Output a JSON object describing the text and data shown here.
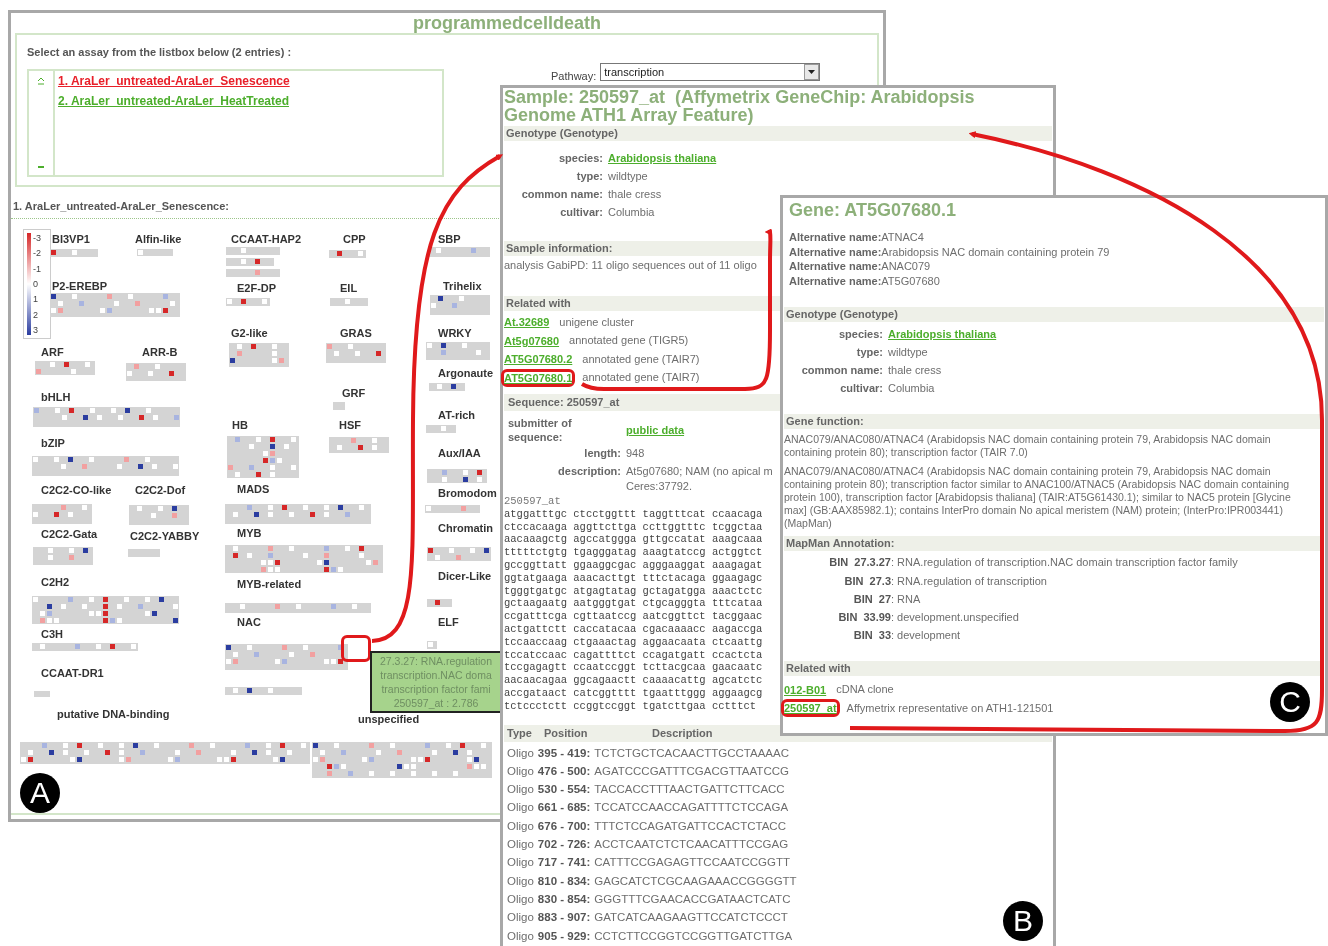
{
  "panel_a": {
    "title": "programmedcelldeath",
    "prompt": "Select an assay from the listbox below (2 entries) :",
    "assays": [
      {
        "label": "1. AraLer_untreated-AraLer_Senescence",
        "selected": true
      },
      {
        "label": "2. AraLer_untreated-AraLer_HeatTreated",
        "selected": false
      }
    ],
    "pathway": {
      "label": "Pathway:",
      "value": "transcription"
    },
    "assay_heading": "1. AraLer_untreated-AraLer_Senescence:",
    "legend": [
      "-3",
      "-2",
      "-1",
      "0",
      "1",
      "2",
      "3"
    ],
    "groups": [
      {
        "label": "BI3VP1"
      },
      {
        "label": "Alfin-like"
      },
      {
        "label": "CCAAT-HAP2"
      },
      {
        "label": "CPP"
      },
      {
        "label": "SBP"
      },
      {
        "label": "P2-EREBP"
      },
      {
        "label": "E2F-DP"
      },
      {
        "label": "EIL"
      },
      {
        "label": "Trihelix"
      },
      {
        "label": "G2-like"
      },
      {
        "label": "GRAS"
      },
      {
        "label": "WRKY"
      },
      {
        "label": "ARF"
      },
      {
        "label": "ARR-B"
      },
      {
        "label": "Argonaute"
      },
      {
        "label": "bHLH"
      },
      {
        "label": "GRF"
      },
      {
        "label": "AT-rich"
      },
      {
        "label": "HB"
      },
      {
        "label": "HSF"
      },
      {
        "label": "bZIP"
      },
      {
        "label": "Aux/IAA"
      },
      {
        "label": "C2C2-CO-like"
      },
      {
        "label": "C2C2-Dof"
      },
      {
        "label": "MADS"
      },
      {
        "label": "Bromodom"
      },
      {
        "label": "C2C2-Gata"
      },
      {
        "label": "C2C2-YABBY"
      },
      {
        "label": "MYB"
      },
      {
        "label": "Chromatin"
      },
      {
        "label": "C2H2"
      },
      {
        "label": "MYB-related"
      },
      {
        "label": "Dicer-Like"
      },
      {
        "label": "C3H"
      },
      {
        "label": "NAC"
      },
      {
        "label": "ELF"
      },
      {
        "label": "CCAAT-DR1"
      },
      {
        "label": "putative DNA-binding"
      },
      {
        "label": "unspecified"
      }
    ],
    "tooltip": {
      "lines": [
        "27.3.27: RNA.regulation",
        "transcription.NAC doma",
        "transcription factor fami",
        "250597_at : 2.786"
      ]
    },
    "badge": "A"
  },
  "panel_b": {
    "title": "Sample: 250597_at  (Affymetrix GeneChip: Arabidopsis Genome ATH1 Array Feature)",
    "genotype_header": "Genotype (Genotype)",
    "genotype": [
      {
        "key": "species:",
        "value": "Arabidopsis thaliana",
        "kind": "link"
      },
      {
        "key": "type:",
        "value": "wildtype",
        "kind": "text"
      },
      {
        "key": "common name:",
        "value": "thale cress",
        "kind": "text"
      },
      {
        "key": "cultivar:",
        "value": "Columbia",
        "kind": "text"
      }
    ],
    "sample_info_header": "Sample information:",
    "sample_info": "analysis GabiPD: 11 oligo sequences out of 11 oligo",
    "related_header": "Related with",
    "related": [
      {
        "id": "At.32689",
        "desc": "unigene cluster",
        "highlighted": false
      },
      {
        "id": "At5g07680",
        "desc": "annotated gene (TIGR5)",
        "highlighted": false
      },
      {
        "id": "AT5G07680.2",
        "desc": "annotated gene (TAIR7)",
        "highlighted": false
      },
      {
        "id": "AT5G07680.1",
        "desc": "annotated gene (TAIR7)",
        "highlighted": true
      }
    ],
    "sequence_header": "Sequence: 250597_at",
    "submitter_key": "submitter of sequence:",
    "submitter": "public data",
    "length_key": "length:",
    "length": "948",
    "description_key": "description:",
    "description": [
      "At5g07680; NAM (no apical m",
      "Ceres:37792."
    ],
    "sequence_name": "250597_at",
    "sequence_lines": [
      "atggatttgc ctcctggttt taggtttcat ccaacaga",
      "ctccacaaga aggttcttga ccttggtttc tcggctaa",
      "aacaaagctg agccatggga gttgccatat aaagcaaa",
      "tttttctgtg tgagggatag aaagtatccg actggtct",
      "gccggttatt ggaaggcgac agggaaggat aaagagat",
      "ggtatgaaga aaacacttgt tttctacaga ggaagagc",
      "tgggtgatgc atgagtatag gctagatgga aaactctc",
      "gctaagaatg aatgggtgat ctgcagggta tttcataa",
      "ccgatttcga cgttaatccg aatcggttct tacggaac",
      "actgattctt caccatacaa cgacaaaacc aagaccga",
      "tccaaccaag ctgaaactag aggaacaata ctcaattg",
      "tccatccaac cagattttct ccagatgatt ccactcta",
      "tccgagagtt ccaatccggt tcttacgcaa gaacaatc",
      "aacaacagaa ggcagaactt caaaacattg agcatctc",
      "accgataact catcggtttt tgaatttggg aggaagcg",
      "tctccctctt ccggtccggt tgatcttgaa cctttct"
    ],
    "oligo_columns": [
      "Type",
      "Position",
      "Description"
    ],
    "oligos": [
      {
        "type": "Oligo",
        "position": "395 - 419:",
        "sequence": "TCTCTGCTCACAACTTGCCTAAAAC"
      },
      {
        "type": "Oligo",
        "position": "476 - 500:",
        "sequence": "AGATCCCGATTTCGACGTTAATCCG"
      },
      {
        "type": "Oligo",
        "position": "530 - 554:",
        "sequence": "TACCACCTTTAACTGATTCTTCACC"
      },
      {
        "type": "Oligo",
        "position": "661 - 685:",
        "sequence": "TCCATCCAACCAGATTTTCTCCAGA"
      },
      {
        "type": "Oligo",
        "position": "676 - 700:",
        "sequence": "TTTCTCCAGATGATTCCACTCTACC"
      },
      {
        "type": "Oligo",
        "position": "702 - 726:",
        "sequence": "ACCTCAATCTCTCAACATTTCCGAG"
      },
      {
        "type": "Oligo",
        "position": "717 - 741:",
        "sequence": "CATTTCCGAGAGTTCCAATCCGGTT"
      },
      {
        "type": "Oligo",
        "position": "810 - 834:",
        "sequence": "GAGCATCTCGCAAGAAACCGGGGTT"
      },
      {
        "type": "Oligo",
        "position": "830 - 854:",
        "sequence": "GGGTTTCGAACACCGATAACTCATC"
      },
      {
        "type": "Oligo",
        "position": "883 - 907:",
        "sequence": "GATCATCAAGAAGTTCCATCTCCCT"
      },
      {
        "type": "Oligo",
        "position": "905 - 929:",
        "sequence": "CCTCTTCCGGTCCGGTTGATCTTGA"
      }
    ],
    "badge": "B"
  },
  "panel_c": {
    "title": "Gene: AT5G07680.1",
    "alt_names": [
      {
        "key": "Alternative name:",
        "value": "ATNAC4"
      },
      {
        "key": "Alternative name:",
        "value": "Arabidopsis NAC domain containing protein 79"
      },
      {
        "key": "Alternative name:",
        "value": "ANAC079"
      },
      {
        "key": "Alternative name:",
        "value": "AT5G07680"
      }
    ],
    "genotype_header": "Genotype (Genotype)",
    "genotype": [
      {
        "key": "species:",
        "value": "Arabidopsis thaliana",
        "kind": "link"
      },
      {
        "key": "type:",
        "value": "wildtype",
        "kind": "text"
      },
      {
        "key": "common name:",
        "value": "thale cress",
        "kind": "text"
      },
      {
        "key": "cultivar:",
        "value": "Columbia",
        "kind": "text"
      }
    ],
    "function_header": "Gene function:",
    "functions": [
      "ANAC079/ANAC080/ATNAC4 (Arabidopsis NAC domain containing protein 79, Arabidopsis NAC domain containing protein 80); transcription factor (TAIR 7.0)",
      "ANAC079/ANAC080/ATNAC4 (Arabidopsis NAC domain containing protein 79, Arabidopsis NAC domain containing protein 80); transcription factor similar to ANAC100/ATNAC5 (Arabidopsis NAC domain containing protein 100), transcription factor [Arabidopsis thaliana] (TAIR:AT5G61430.1); similar to NAC5 protein [Glycine max] (GB:AAX85982.1); contains InterPro domain No apical meristem (NAM) protein; (InterPro:IPR003441) (MapMan)"
    ],
    "mapman_header": "MapMan Annotation:",
    "bins": [
      {
        "bin": "BIN  27.3.27",
        "desc": ": RNA.regulation of transcription.NAC domain transcription factor family"
      },
      {
        "bin": "BIN  27.3",
        "desc": ": RNA.regulation of transcription"
      },
      {
        "bin": "BIN  27",
        "desc": ": RNA"
      },
      {
        "bin": "BIN  33.99",
        "desc": ": development.unspecified"
      },
      {
        "bin": "BIN  33",
        "desc": ": development"
      }
    ],
    "related_header": "Related with",
    "related": [
      {
        "id": "012-B01",
        "desc": "cDNA clone",
        "highlighted": false
      },
      {
        "id": "250597_at",
        "desc": "Affymetrix representative on ATH1-121501",
        "highlighted": true
      }
    ],
    "badge": "C"
  }
}
